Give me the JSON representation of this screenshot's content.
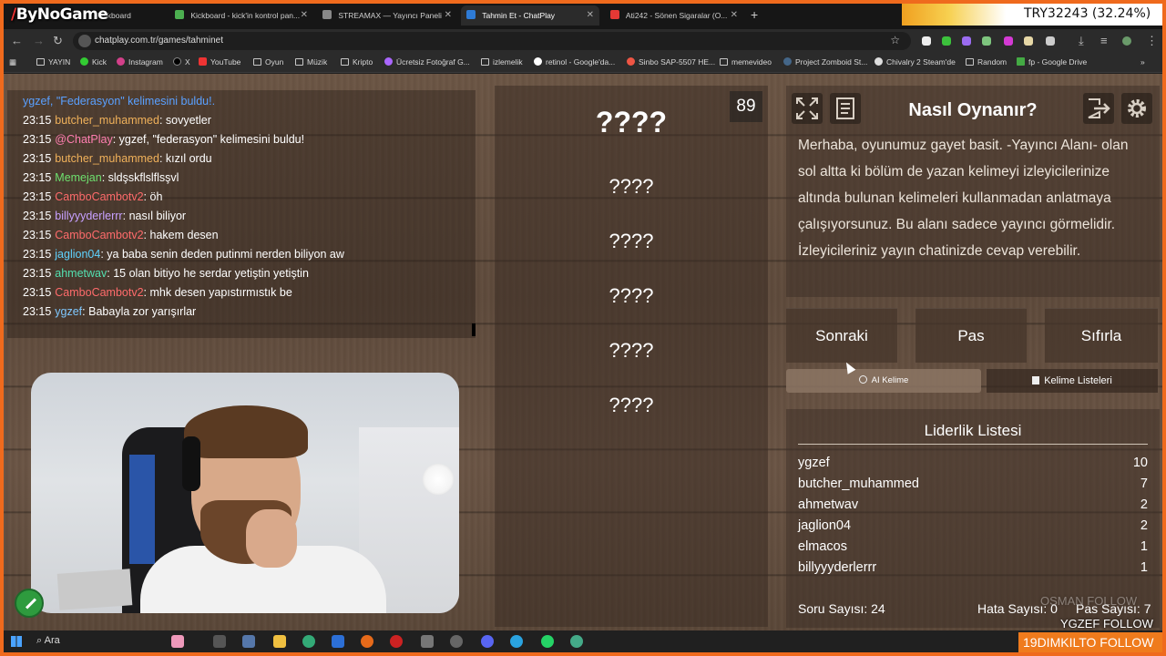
{
  "browser": {
    "tabs": [
      {
        "label": "Kickboard",
        "active": false,
        "color": "#4caf50"
      },
      {
        "label": "Kickboard - kick'in kontrol pan...",
        "active": false,
        "color": "#4caf50"
      },
      {
        "label": "STREAMAX — Yayıncı Paneli",
        "active": false,
        "color": "#888888"
      },
      {
        "label": "Tahmin Et - ChatPlay",
        "active": true,
        "color": "#2e7bd6"
      },
      {
        "label": "Ati242 - Sönen Sigaralar (O...",
        "active": false,
        "color": "#e53935"
      }
    ],
    "url": "chatplay.com.tr/games/tahminet",
    "bookmarks": [
      "YAYIN",
      "Kick",
      "Instagram",
      "X",
      "YouTube",
      "Oyun",
      "Müzik",
      "Kripto",
      "Ücretsiz Fotoğraf G...",
      "izlemelik",
      "retinol - Google'da...",
      "Sinbo SAP-5507 HE...",
      "memevideo",
      "Project Zomboid St...",
      "Chivalry 2 Steam'de",
      "Random",
      "fp - Google Drive"
    ]
  },
  "overlay": {
    "logo_prefix": "/",
    "logo_text": "ByNoGame",
    "donation": "TRY32243 (32.24%)",
    "follow_banner": "19DIMKILTO  FOLLOW",
    "follow_ghost": "YGZEF  FOLLOW",
    "follow_ghost2": "OSMAN FOLLOW"
  },
  "chat": {
    "top_partial": {
      "user": "ygzef, \"Federasyon\" kelimesini buldu!.",
      "color": "#5aa0ff"
    },
    "messages": [
      {
        "time": "23:15",
        "user": "butcher_muhammed",
        "color": "#f0b15a",
        "text": "sovyetler"
      },
      {
        "time": "23:15",
        "user": "@ChatPlay",
        "color": "#ff7eb0",
        "text": "ygzef, \"federasyon\" kelimesini buldu!"
      },
      {
        "time": "23:15",
        "user": "butcher_muhammed",
        "color": "#f0b15a",
        "text": "kızıl ordu"
      },
      {
        "time": "23:15",
        "user": "Memejan",
        "color": "#6ee06e",
        "text": "sldşskflslflsşvl"
      },
      {
        "time": "23:15",
        "user": "CamboCambotv2",
        "color": "#ff6b6b",
        "text": "öh"
      },
      {
        "time": "23:15",
        "user": "billyyyderlerrr",
        "color": "#c7a0ff",
        "text": "nasıl biliyor"
      },
      {
        "time": "23:15",
        "user": "CamboCambotv2",
        "color": "#ff6b6b",
        "text": "hakem desen"
      },
      {
        "time": "23:15",
        "user": "jaglion04",
        "color": "#5fd3ff",
        "text": "ya baba senin deden putinmi nerden biliyon aw"
      },
      {
        "time": "23:15",
        "user": "ahmetwav",
        "color": "#53e0b0",
        "text": "15 olan bitiyo he serdar yetiştin yetiştin"
      },
      {
        "time": "23:15",
        "user": "CamboCambotv2",
        "color": "#ff6b6b",
        "text": "mhk desen yapıstırmıstık be"
      },
      {
        "time": "23:15",
        "user": "ygzef",
        "color": "#7fc8ff",
        "text": "Babayla zor yarışırlar"
      }
    ]
  },
  "game": {
    "counter": "89",
    "main_word": "????",
    "words": [
      "????",
      "????",
      "????",
      "????",
      "????"
    ]
  },
  "howto": {
    "title": "Nasıl Oynanır?",
    "body": "Merhaba, oyunumuz gayet basit. -Yayıncı Alanı- olan sol altta ki bölüm de yazan kelimeyi izleyicilerinize altında bulunan kelimeleri kullanmadan anlatmaya çalışıyorsunuz. Bu alanı sadece yayıncı görmelidir. İzleyicileriniz yayın chatinizde cevap verebilir."
  },
  "controls": {
    "next": "Sonraki",
    "pass": "Pas",
    "reset": "Sıfırla",
    "ai_word": "AI Kelime",
    "word_lists": "Kelime Listeleri"
  },
  "leaderboard": {
    "title": "Liderlik Listesi",
    "rows": [
      {
        "name": "ygzef",
        "score": "10"
      },
      {
        "name": "butcher_muhammed",
        "score": "7"
      },
      {
        "name": "ahmetwav",
        "score": "2"
      },
      {
        "name": "jaglion04",
        "score": "2"
      },
      {
        "name": "elmacos",
        "score": "1"
      },
      {
        "name": "billyyyderlerrr",
        "score": "1"
      }
    ],
    "questions": "Soru Sayısı: 24",
    "errors": "Hata Sayısı: 0",
    "passes": "Pas Sayısı: 7"
  },
  "taskbar": {
    "search": "Ara"
  }
}
